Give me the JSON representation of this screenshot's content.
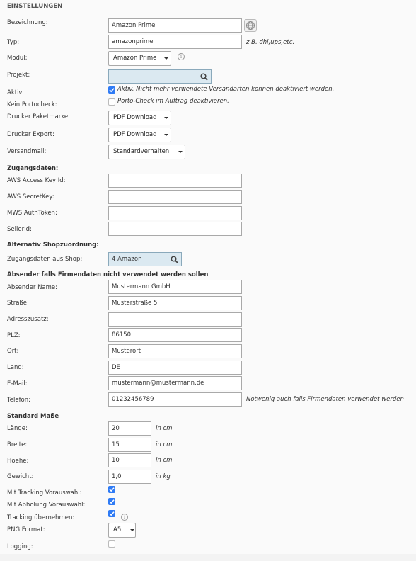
{
  "section_title": "EINSTELLUNGEN",
  "fields": {
    "bezeichnung": {
      "label": "Bezeichnung:",
      "value": "Amazon Prime"
    },
    "typ": {
      "label": "Typ:",
      "value": "amazonprime",
      "hint": "z.B. dhl,ups,etc."
    },
    "modul": {
      "label": "Modul:",
      "value": "Amazon Prime"
    },
    "projekt": {
      "label": "Projekt:",
      "value": ""
    },
    "aktiv": {
      "label": "Aktiv:",
      "checked": true,
      "hint": "Aktiv. Nicht mehr verwendete Versandarten können deaktiviert werden."
    },
    "kein_portocheck": {
      "label": "Kein Portocheck:",
      "checked": false,
      "hint": "Porto-Check im Auftrag deaktivieren."
    },
    "drucker_paketmarke": {
      "label": "Drucker Paketmarke:",
      "value": "PDF Download"
    },
    "drucker_export": {
      "label": "Drucker Export:",
      "value": "PDF Download"
    },
    "versandmail": {
      "label": "Versandmail:",
      "value": "Standardverhalten"
    }
  },
  "zugangsdaten": {
    "title": "Zugangsdaten:",
    "aws_access_key": {
      "label": "AWS Access Key Id:",
      "value": ""
    },
    "aws_secret_key": {
      "label": "AWS SecretKey:",
      "value": ""
    },
    "mws_auth_token": {
      "label": "MWS AuthToken:",
      "value": ""
    },
    "seller_id": {
      "label": "SellerId:",
      "value": ""
    }
  },
  "shopzuordnung": {
    "title": "Alternativ Shopzuordnung:",
    "shop": {
      "label": "Zugangsdaten aus Shop:",
      "value": "4 Amazon"
    }
  },
  "absender": {
    "title": "Absender falls Firmendaten nicht verwendet werden sollen",
    "name": {
      "label": "Absender Name:",
      "value": "Mustermann GmbH"
    },
    "strasse": {
      "label": "Straße:",
      "value": "Musterstraße 5"
    },
    "adresszusatz": {
      "label": "Adresszusatz:",
      "value": ""
    },
    "plz": {
      "label": "PLZ:",
      "value": "86150"
    },
    "ort": {
      "label": "Ort:",
      "value": "Musterort"
    },
    "land": {
      "label": "Land:",
      "value": "DE"
    },
    "email": {
      "label": "E-Mail:",
      "value": "mustermann@mustermann.de"
    },
    "telefon": {
      "label": "Telefon:",
      "value": "01232456789",
      "hint": "Notwenig auch falls Firmendaten verwendet werden"
    }
  },
  "masse": {
    "title": "Standard Maße",
    "laenge": {
      "label": "Länge:",
      "value": "20",
      "unit": "in cm"
    },
    "breite": {
      "label": "Breite:",
      "value": "15",
      "unit": "in cm"
    },
    "hoehe": {
      "label": "Hoehe:",
      "value": "10",
      "unit": "in cm"
    },
    "gewicht": {
      "label": "Gewicht:",
      "value": "1,0",
      "unit": "in kg"
    }
  },
  "options": {
    "tracking_vorauswahl": {
      "label": "Mit Tracking Vorauswahl:",
      "checked": true
    },
    "abholung_vorauswahl": {
      "label": "Mit Abholung Vorauswahl:",
      "checked": true
    },
    "tracking_uebernehmen": {
      "label": "Tracking übernehmen:",
      "checked": true
    },
    "png_format": {
      "label": "PNG Format:",
      "value": "A5"
    },
    "logging": {
      "label": "Logging:",
      "checked": false
    }
  },
  "colors": {
    "checkbox_on": "#2f7bf5",
    "search_bg": "#dbe9f1"
  }
}
